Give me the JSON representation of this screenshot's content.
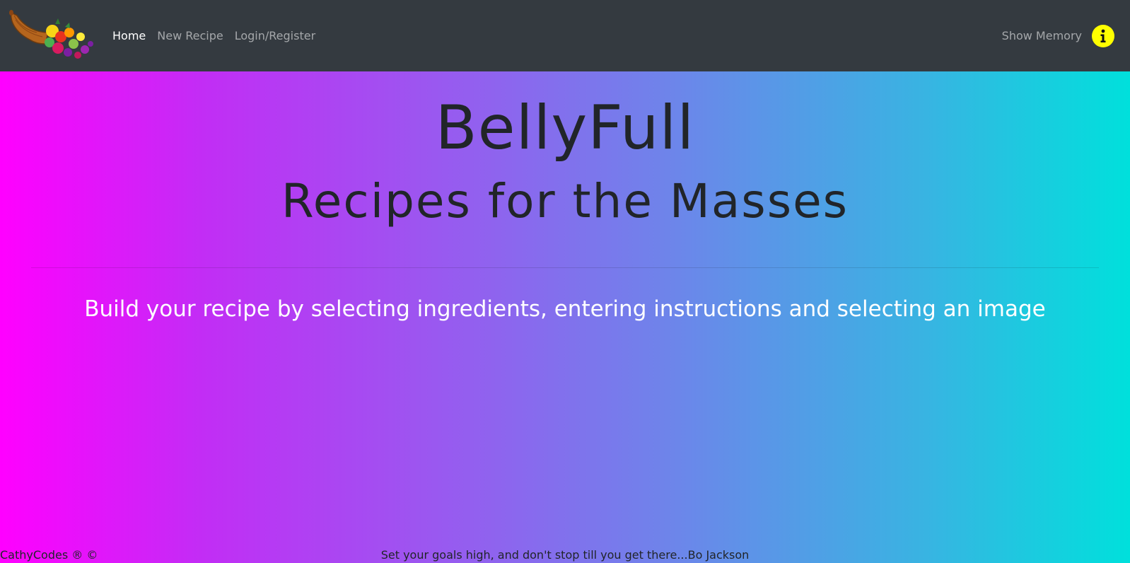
{
  "navbar": {
    "logo_alt": "cornucopia",
    "links": [
      {
        "label": "Home",
        "active": true
      },
      {
        "label": "New Recipe",
        "active": false
      },
      {
        "label": "Login/Register",
        "active": false
      }
    ],
    "show_memory_label": "Show Memory",
    "info_icon": "info-icon",
    "info_color": "#ffff00"
  },
  "hero": {
    "title": "BellyFull",
    "subtitle": "Recipes for the Masses",
    "lead": "Build your recipe by selecting ingredients, entering instructions and selecting an image"
  },
  "footer": {
    "brand": "CathyCodes ® ©",
    "quote": "Set your goals high, and don't stop till you get there...Bo Jackson"
  },
  "colors": {
    "navbar_bg": "#343a40",
    "gradient_start": "#ff00ff",
    "gradient_end": "#00e0dc"
  }
}
